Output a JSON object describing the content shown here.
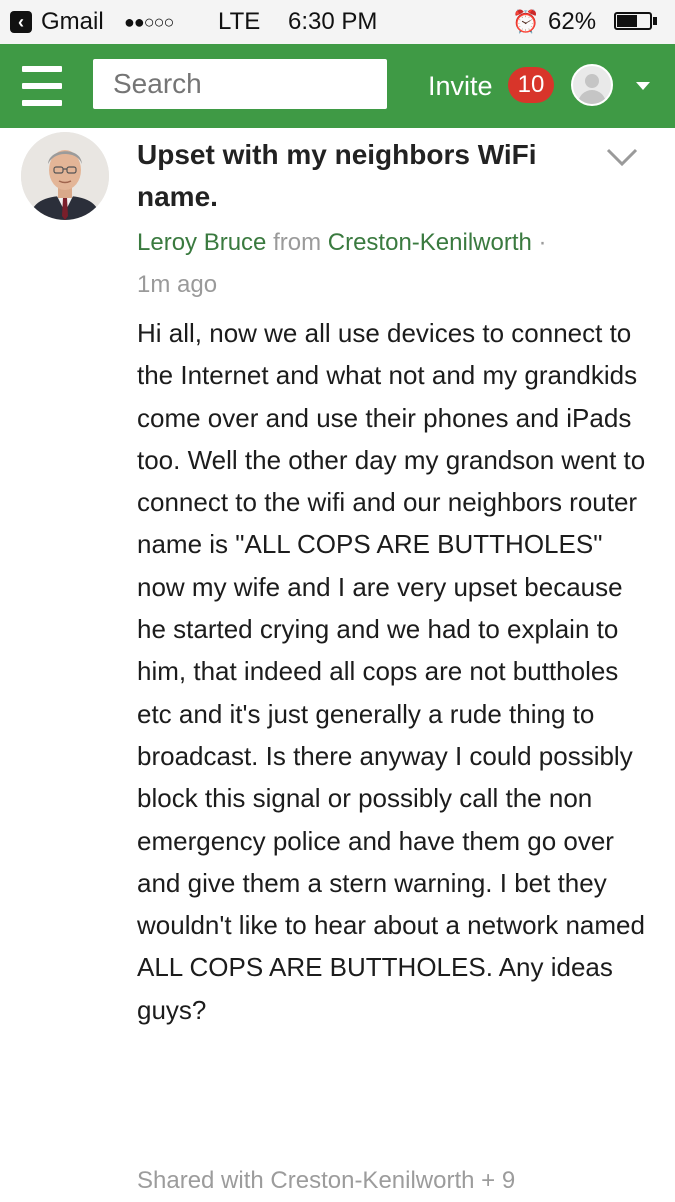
{
  "status_bar": {
    "back_app": "Gmail",
    "signal_dots": "●●○○○",
    "network": "LTE",
    "time": "6:30 PM",
    "alarm_icon": "alarm-clock-icon",
    "battery_percent": "62%",
    "battery_level": 0.62
  },
  "header": {
    "search": {
      "placeholder": "Search",
      "value": ""
    },
    "invite_label": "Invite",
    "invite_count": "10",
    "brand_color": "#3f9a45",
    "badge_color": "#d8352a"
  },
  "post": {
    "title": "Upset with my neighbors WiFi name.",
    "author": "Leroy Bruce",
    "from_word": "from",
    "neighborhood": "Creston-Kenilworth",
    "separator": "·",
    "time_ago": "1m ago",
    "body": "Hi all, now we all use devices to connect to the Internet and what not and my grandkids come over and use their phones and iPads too. Well the other day my grandson went to connect to the wifi and our neighbors router name is \"ALL COPS ARE BUTTHOLES\" now my wife and I are very upset because he started crying and we had to explain to him, that indeed all cops are not buttholes etc and it's just generally a rude thing to broadcast. Is there anyway I could possibly block this signal or possibly call the non emergency police and have them go over and give them a stern warning. I bet they wouldn't like to hear about a network named ALL COPS ARE BUTTHOLES. Any ideas guys?",
    "shared_with": "Shared with Creston-Kenilworth + 9",
    "link_color": "#3a7a3f"
  }
}
